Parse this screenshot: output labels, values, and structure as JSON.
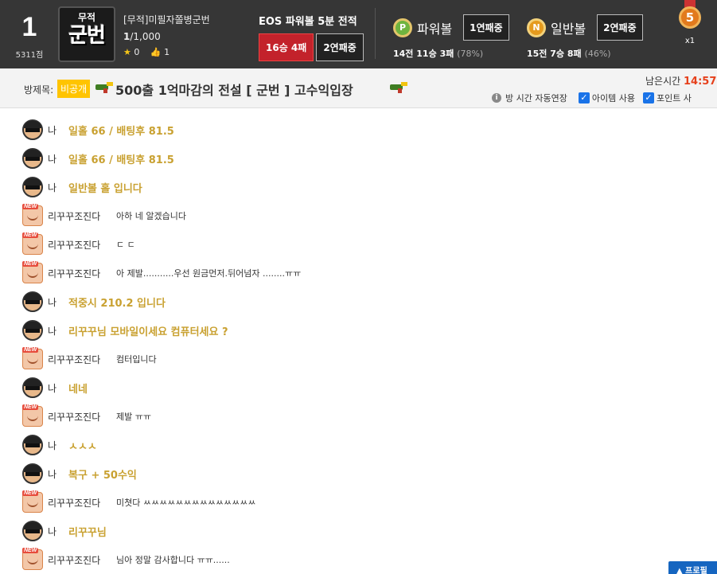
{
  "header": {
    "rank": "1",
    "points": "5311점",
    "logo_top": "무적",
    "logo_main": "군번",
    "user_name": "[무적]미필자쫄병군번",
    "level_current": "1",
    "level_total": "/1,000",
    "stars": "0",
    "likes": "1",
    "record_title": "EOS 파워볼 5분 전적",
    "record_wins_losses": "16승 4패",
    "record_streak": "2연패중",
    "powerball": {
      "icon": "P",
      "label": "파워볼",
      "streak": "1연패중",
      "games": "14전",
      "wins": "11승",
      "losses": "3패",
      "pct": "(78%)"
    },
    "normalball": {
      "icon": "N",
      "label": "일반볼",
      "streak": "2연패중",
      "games": "15전",
      "wins": "7승",
      "losses": "8패",
      "pct": "(46%)"
    },
    "medal_number": "5",
    "medal_count": "x1"
  },
  "room": {
    "label": "방제목:",
    "private_badge": "비공개",
    "title": "500출 1억마감의 전설 [ 군번 ] 고수익입장",
    "time_label": "남은시간",
    "time_value": "14:57:",
    "opt_auto_extend": "방 시간 자동연장",
    "opt_item": "아이템 사용",
    "opt_point": "포인트 사"
  },
  "chat": [
    {
      "who": "me",
      "nick": "나",
      "text": "일홀 66 / 배팅후 81.5"
    },
    {
      "who": "me",
      "nick": "나",
      "text": "일홀 66 / 배팅후 81.5"
    },
    {
      "who": "me",
      "nick": "나",
      "text": "일반볼 홀 입니다"
    },
    {
      "who": "other",
      "nick": "리꾸꾸조진다",
      "text": "아하 네 알겠습니다"
    },
    {
      "who": "other",
      "nick": "리꾸꾸조진다",
      "text": "ㄷ ㄷ"
    },
    {
      "who": "other",
      "nick": "리꾸꾸조진다",
      "text": "아 제발...........우선 원금먼저.뒤어넘자 ........ㅠㅠ"
    },
    {
      "who": "me",
      "nick": "나",
      "text": "적중시 210.2 입니다"
    },
    {
      "who": "me",
      "nick": "나",
      "text": "리꾸꾸님 모바일이세요 컴퓨터세요 ?"
    },
    {
      "who": "other",
      "nick": "리꾸꾸조진다",
      "text": "컴터입니다"
    },
    {
      "who": "me",
      "nick": "나",
      "text": "네네"
    },
    {
      "who": "other",
      "nick": "리꾸꾸조진다",
      "text": "제발 ㅠㅠ"
    },
    {
      "who": "me",
      "nick": "나",
      "text": "ㅅㅅㅅ"
    },
    {
      "who": "me",
      "nick": "나",
      "text": "복구 + 50수익"
    },
    {
      "who": "other",
      "nick": "리꾸꾸조진다",
      "text": "미쳣다 ㅆㅆㅆㅆㅆㅆㅆㅆㅆㅆㅆㅆㅆㅆ"
    },
    {
      "who": "me",
      "nick": "나",
      "text": "리꾸꾸님"
    },
    {
      "who": "other",
      "nick": "리꾸꾸조진다",
      "text": "님아 정말 감사합니다 ㅠㅠ......"
    }
  ],
  "profile_button": "▲ 프로필"
}
